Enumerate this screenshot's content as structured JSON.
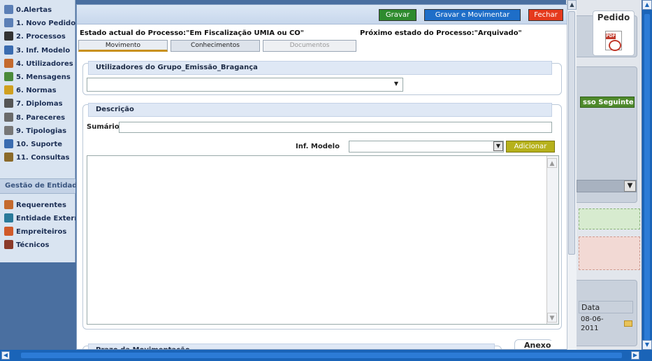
{
  "sidebar": {
    "items": [
      {
        "label": "0.Alertas",
        "icon": "info-icon",
        "color": "#5b7fb6"
      },
      {
        "label": "1. Novo Pedido",
        "icon": "plus-icon",
        "color": "#5b7fb6"
      },
      {
        "label": "2. Processos",
        "icon": "document-icon",
        "color": "#333333"
      },
      {
        "label": "3. Inf. Modelo",
        "icon": "edit-icon",
        "color": "#3a6cb0"
      },
      {
        "label": "4. Utilizadores",
        "icon": "users-icon",
        "color": "#c46a2e"
      },
      {
        "label": "5. Mensagens",
        "icon": "message-icon",
        "color": "#4a8a3a"
      },
      {
        "label": "6. Normas",
        "icon": "book-icon",
        "color": "#d0a020"
      },
      {
        "label": "7. Diplomas",
        "icon": "diploma-icon",
        "color": "#555555"
      },
      {
        "label": "8. Pareceres",
        "icon": "clipboard-icon",
        "color": "#6a6a6a"
      },
      {
        "label": "9. Tipologias",
        "icon": "list-icon",
        "color": "#777777"
      },
      {
        "label": "10. Suporte",
        "icon": "support-icon",
        "color": "#3a6cb0"
      },
      {
        "label": "11. Consultas",
        "icon": "tools-icon",
        "color": "#8a6a2a"
      }
    ],
    "section_title": "Gestão de Entidades",
    "entities": [
      {
        "label": "Requerentes",
        "icon": "people-icon",
        "color": "#c46a2e"
      },
      {
        "label": "Entidade Externa",
        "icon": "entity-icon",
        "color": "#2a7a9a"
      },
      {
        "label": "Empreiteiros",
        "icon": "house-icon",
        "color": "#d05a2a"
      },
      {
        "label": "Técnicos",
        "icon": "person-icon",
        "color": "#8a3a2a"
      }
    ]
  },
  "modal": {
    "buttons": {
      "gravar": "Gravar",
      "gravar_movimentar": "Gravar e Movimentar",
      "fechar": "Fechar"
    },
    "estado": "Estado actual do Processo:\"Em Fiscalização UMIA ou CO\"",
    "proximo": "Próximo estado do Processo:\"Arquivado\"",
    "tabs": [
      "Movimento",
      "Conhecimentos",
      "Documentos"
    ],
    "utilizadores_legend": "Utilizadores do Grupo_Emissão_Bragança",
    "descricao_legend": "Descrição",
    "sumario_label": "Sumário",
    "sumario_value": "",
    "modelo_label": "Inf. Modelo",
    "adicionar": "Adicionar",
    "prazo_legend": "Prazo da Movimentação",
    "anexo": "Anexo"
  },
  "right_panel": {
    "pedido": "Pedido",
    "processo_seguinte": "sso Seguinte",
    "data_header": "Data",
    "data_value": "08-06-2011"
  }
}
